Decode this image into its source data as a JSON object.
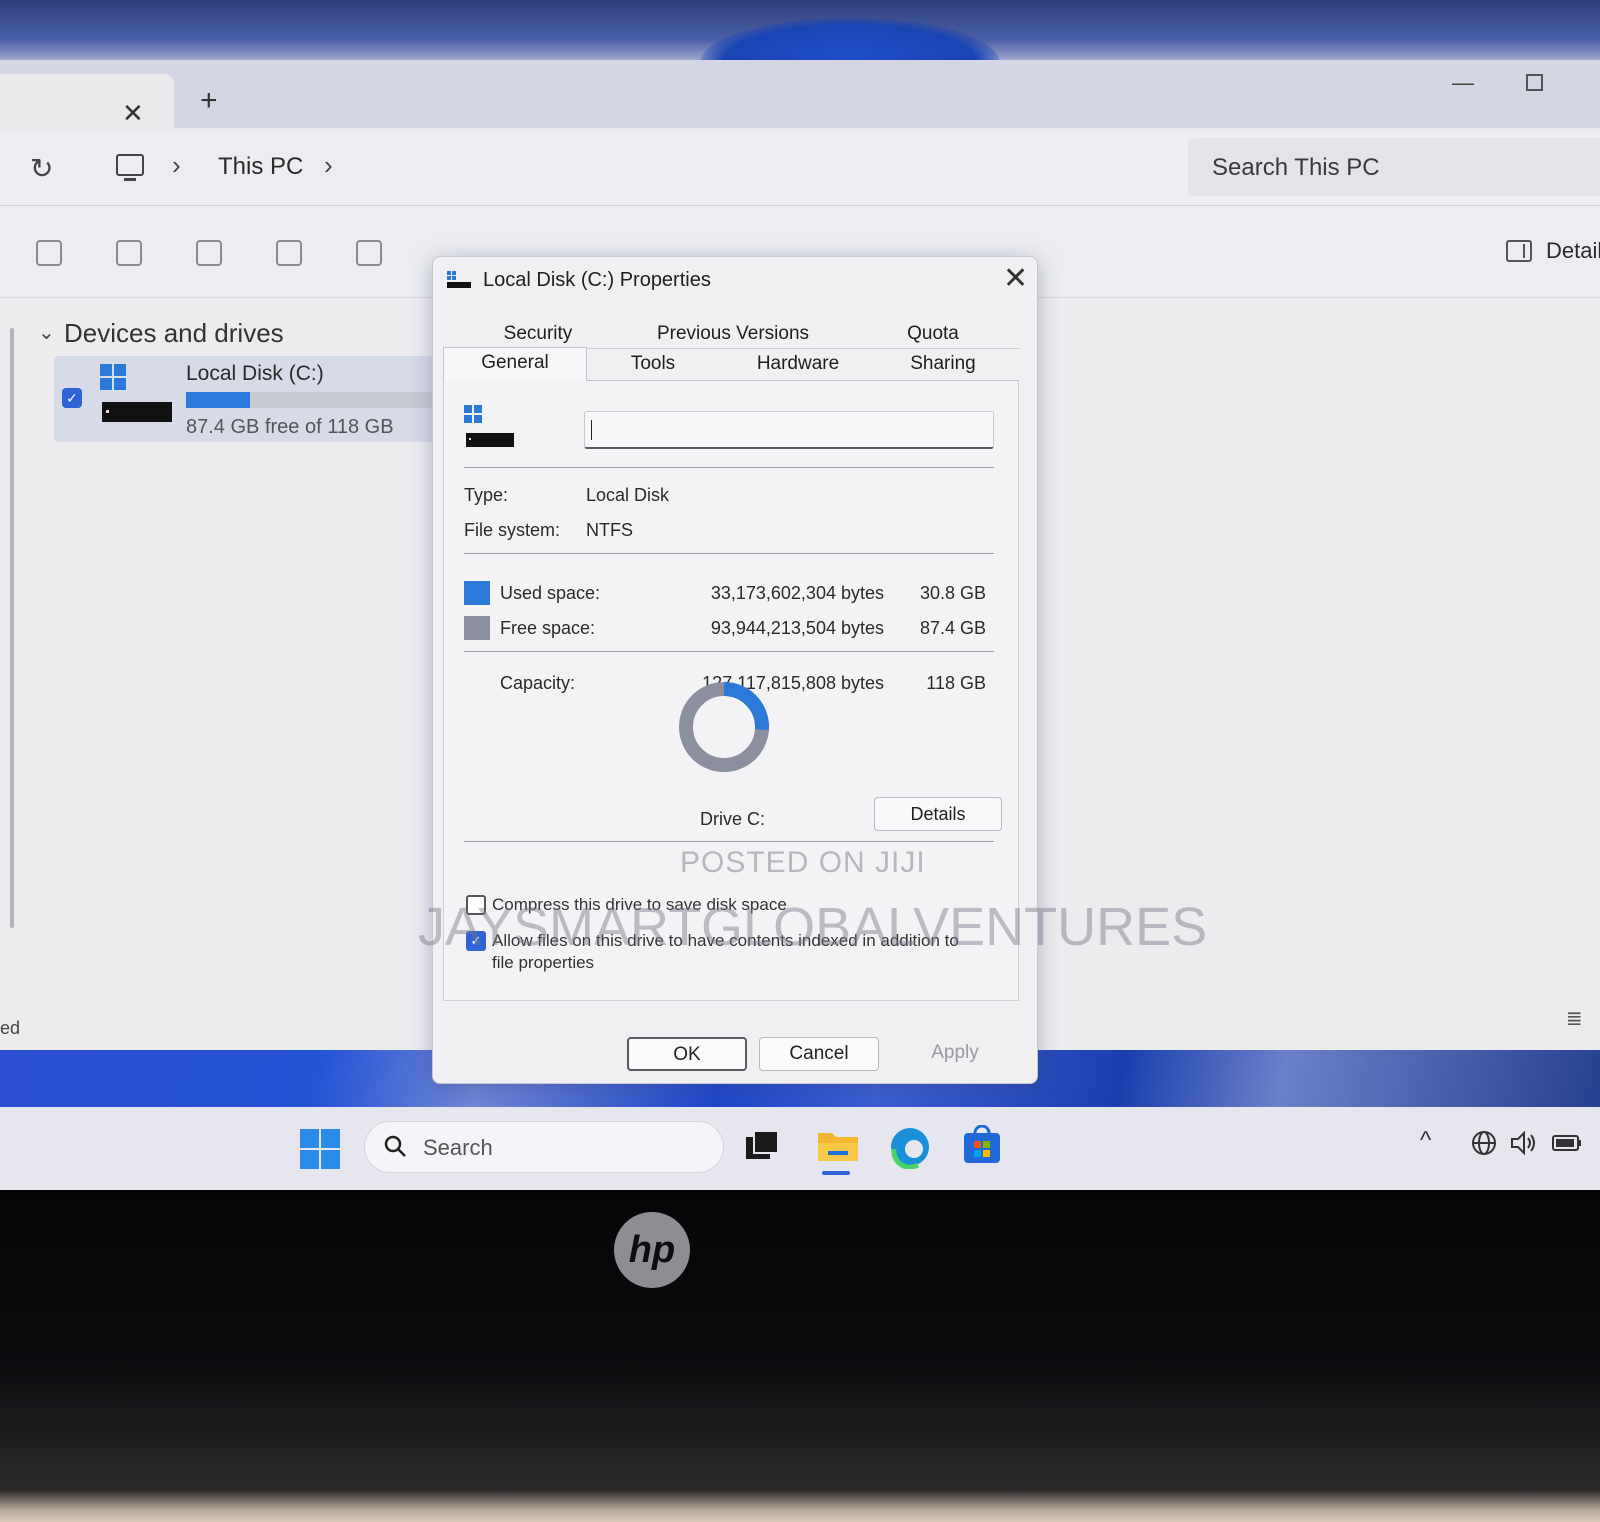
{
  "explorer": {
    "tab_close": "✕",
    "tab_new": "+",
    "window_minimize": "—",
    "breadcrumb": {
      "sep1": "›",
      "location": "This PC",
      "sep2": "›"
    },
    "search_placeholder": "Search This PC",
    "toolbar": {
      "details_label": "Detail"
    },
    "sidebar": {
      "section_title": "Devices and drives"
    },
    "drive_tile": {
      "name": "Local Disk (C:)",
      "free_text": "87.4 GB free of 118 GB",
      "used_fraction": 0.26
    },
    "status_left": "ed"
  },
  "dialog": {
    "title": "Local Disk (C:) Properties",
    "close": "✕",
    "tabs_row1": [
      "Security",
      "Previous Versions",
      "Quota"
    ],
    "tabs_row2": [
      "General",
      "Tools",
      "Hardware",
      "Sharing"
    ],
    "active_tab": "General",
    "type_label": "Type:",
    "type_value": "Local Disk",
    "fs_label": "File system:",
    "fs_value": "NTFS",
    "used_label": "Used space:",
    "used_bytes": "33,173,602,304 bytes",
    "used_gb": "30.8 GB",
    "free_label": "Free space:",
    "free_bytes": "93,944,213,504 bytes",
    "free_gb": "87.4 GB",
    "capacity_label": "Capacity:",
    "capacity_bytes": "127,117,815,808 bytes",
    "capacity_gb": "118 GB",
    "drive_label": "Drive C:",
    "details_button": "Details",
    "compress_label": "Compress this drive to save disk space",
    "compress_checked": false,
    "index_label_line1": "Allow files on this drive to have contents indexed in addition to",
    "index_label_line2": "file properties",
    "index_checked": true,
    "ok": "OK",
    "cancel": "Cancel",
    "apply": "Apply",
    "colors": {
      "used": "#2b79d8",
      "free": "#8c8fa0"
    }
  },
  "watermarks": {
    "line1": "POSTED ON JIJI",
    "line2": "JAYSMARTGLOBALVENTURES"
  },
  "taskbar": {
    "search_placeholder": "Search",
    "tray_chevron": "^",
    "icons": [
      "start-icon",
      "search-icon",
      "task-view-icon",
      "file-explorer-icon",
      "edge-icon",
      "store-icon",
      "network-icon",
      "volume-icon",
      "battery-icon"
    ]
  },
  "bezel": {
    "logo": "hp"
  }
}
